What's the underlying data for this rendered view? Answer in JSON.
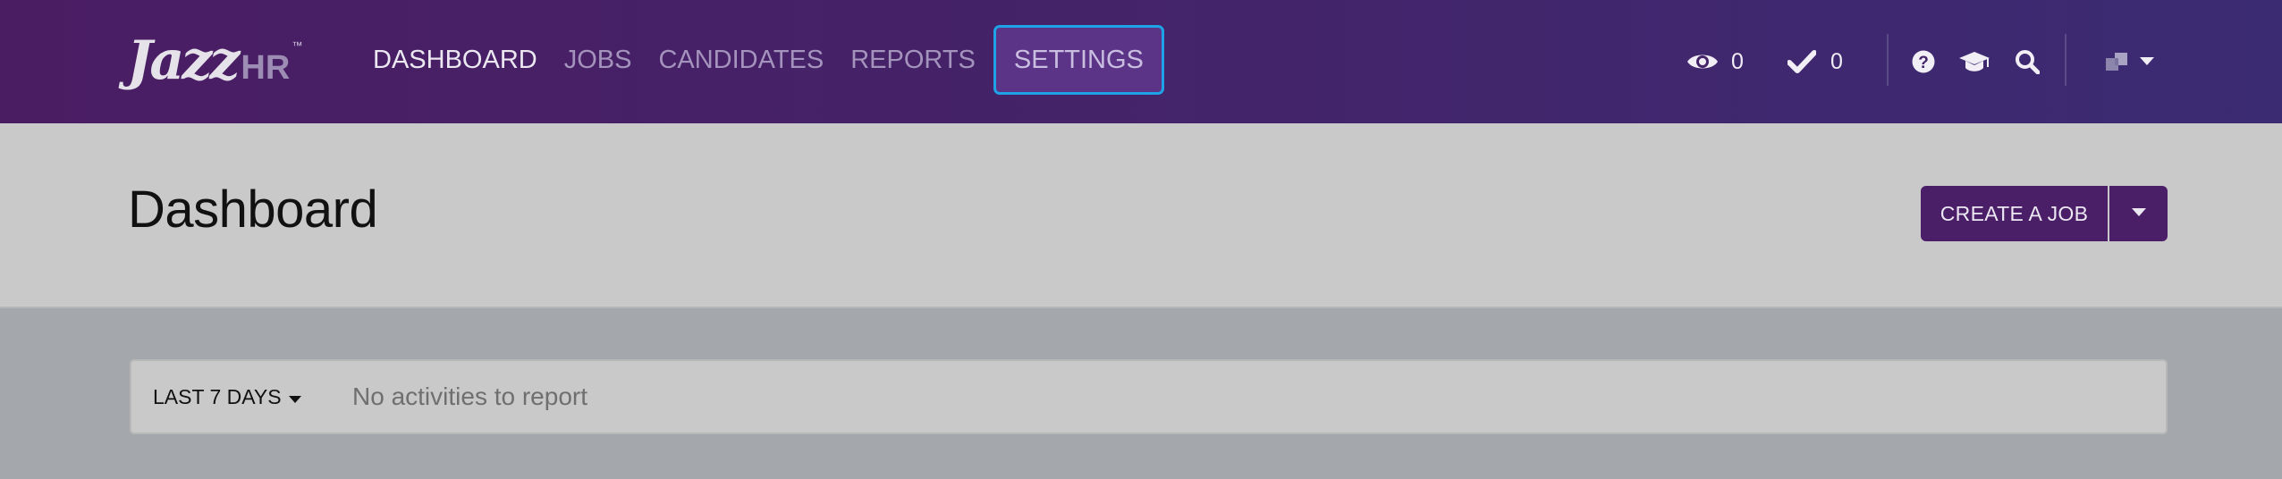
{
  "app": {
    "logo_primary": "Jazz",
    "logo_secondary": "HR",
    "logo_mark": "™"
  },
  "nav": {
    "items": [
      {
        "label": "DASHBOARD",
        "state": "active"
      },
      {
        "label": "JOBS",
        "state": "normal"
      },
      {
        "label": "CANDIDATES",
        "state": "normal"
      },
      {
        "label": "REPORTS",
        "state": "normal"
      },
      {
        "label": "SETTINGS",
        "state": "focused"
      }
    ]
  },
  "toolbar": {
    "watch_icon": "eye-icon",
    "watch_count": "0",
    "tasks_icon": "check-icon",
    "tasks_count": "0",
    "help_icon": "question-circle-icon",
    "academy_icon": "graduation-cap-icon",
    "search_icon": "search-icon",
    "account_icon": "company-logo-icon",
    "account_caret_icon": "caret-down-icon"
  },
  "header": {
    "title": "Dashboard",
    "create_button_label": "CREATE A JOB",
    "create_dropdown_icon": "caret-down-icon"
  },
  "activity": {
    "range_label": "LAST 7 DAYS",
    "empty_message": "No activities to report"
  },
  "colors": {
    "nav_bg": "#4a1d63",
    "primary_button": "#4b1e68",
    "focus_ring": "#1ea4e6",
    "page_bg": "#a4a7ab",
    "header_bg": "#c9c9c9"
  }
}
